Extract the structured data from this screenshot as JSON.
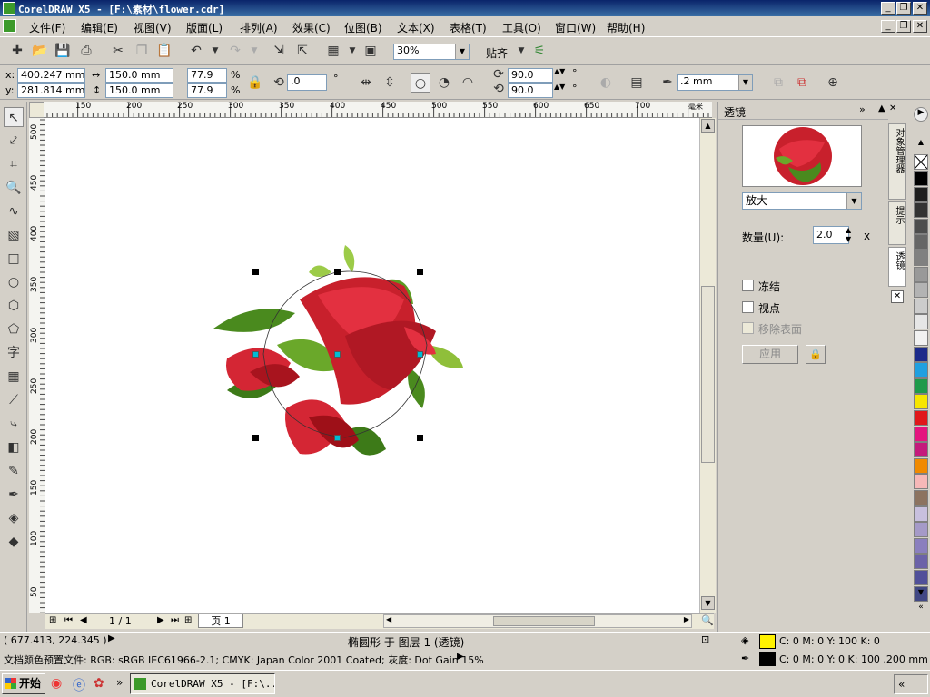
{
  "window": {
    "title": "CorelDRAW X5 - [F:\\素材\\flower.cdr]",
    "minimize": "_",
    "restore": "❐",
    "close": "✕"
  },
  "menu": [
    "文件(F)",
    "编辑(E)",
    "视图(V)",
    "版面(L)",
    "排列(A)",
    "效果(C)",
    "位图(B)",
    "文本(X)",
    "表格(T)",
    "工具(O)",
    "窗口(W)",
    "帮助(H)"
  ],
  "toolbar": {
    "zoom": "30%",
    "snap": "贴齐"
  },
  "properties": {
    "x_label": "x:",
    "x": "400.247 mm",
    "y_label": "y:",
    "y": "281.814 mm",
    "width": "150.0 mm",
    "height": "150.0 mm",
    "scale_x": "77.9",
    "scale_y": "77.9",
    "percent": "%",
    "rotation": ".0",
    "degree": "°",
    "start_angle": "90.0",
    "end_angle": "90.0",
    "outline_width": ".2 mm"
  },
  "ruler": {
    "h_ticks": [
      "150",
      "200",
      "250",
      "300",
      "350",
      "400",
      "450",
      "500",
      "550",
      "600",
      "650",
      "700"
    ],
    "h_unit": "毫米",
    "v_ticks": [
      "500",
      "450",
      "400",
      "350",
      "300",
      "250",
      "200",
      "150",
      "100",
      "50"
    ]
  },
  "page_nav": {
    "counter": "1 / 1",
    "tab": "页 1"
  },
  "docker": {
    "title": "透镜",
    "lens_type": "放大",
    "amount_label": "数量(U):",
    "amount": "2.0",
    "amount_unit": "x",
    "freeze": "冻结",
    "viewpoint": "视点",
    "remove_face": "移除表面",
    "apply": "应用"
  },
  "side_tabs": [
    "对象管理器",
    "提示",
    "透镜"
  ],
  "palette": [
    "#ffffff",
    "#000000",
    "#1e1e1e",
    "#333333",
    "#4d4d4d",
    "#666666",
    "#808080",
    "#999999",
    "#b3b3b3",
    "#cccccc",
    "#e6e6e6",
    "#f2f2f2",
    "#1b2a8a",
    "#1fa0e0",
    "#1e9a4a",
    "#f7e600",
    "#e0181b",
    "#e4157f",
    "#c41a7c",
    "#f08a00",
    "#f6b8b8",
    "#8c7360",
    "#c8c0de",
    "#a59ac8",
    "#8a7fbe",
    "#6b62a8",
    "#50509a",
    "#414884"
  ],
  "status": {
    "coords": "( 677.413, 224.345 )",
    "selection": "椭圆形 于 图层 1 (透镜)",
    "profile": "文档颜色预置文件: RGB: sRGB IEC61966-2.1; CMYK: Japan Color 2001 Coated; 灰度: Dot Gain 15%",
    "fill": "C: 0 M: 0 Y: 100 K: 0",
    "fill_color": "#fff200",
    "outline": "C: 0 M: 0 Y: 0 K: 100  .200 mm",
    "outline_color": "#000000"
  },
  "taskbar": {
    "start": "开始",
    "task": "CorelDRAW X5 - [F:\\...",
    "chevron": "«"
  }
}
